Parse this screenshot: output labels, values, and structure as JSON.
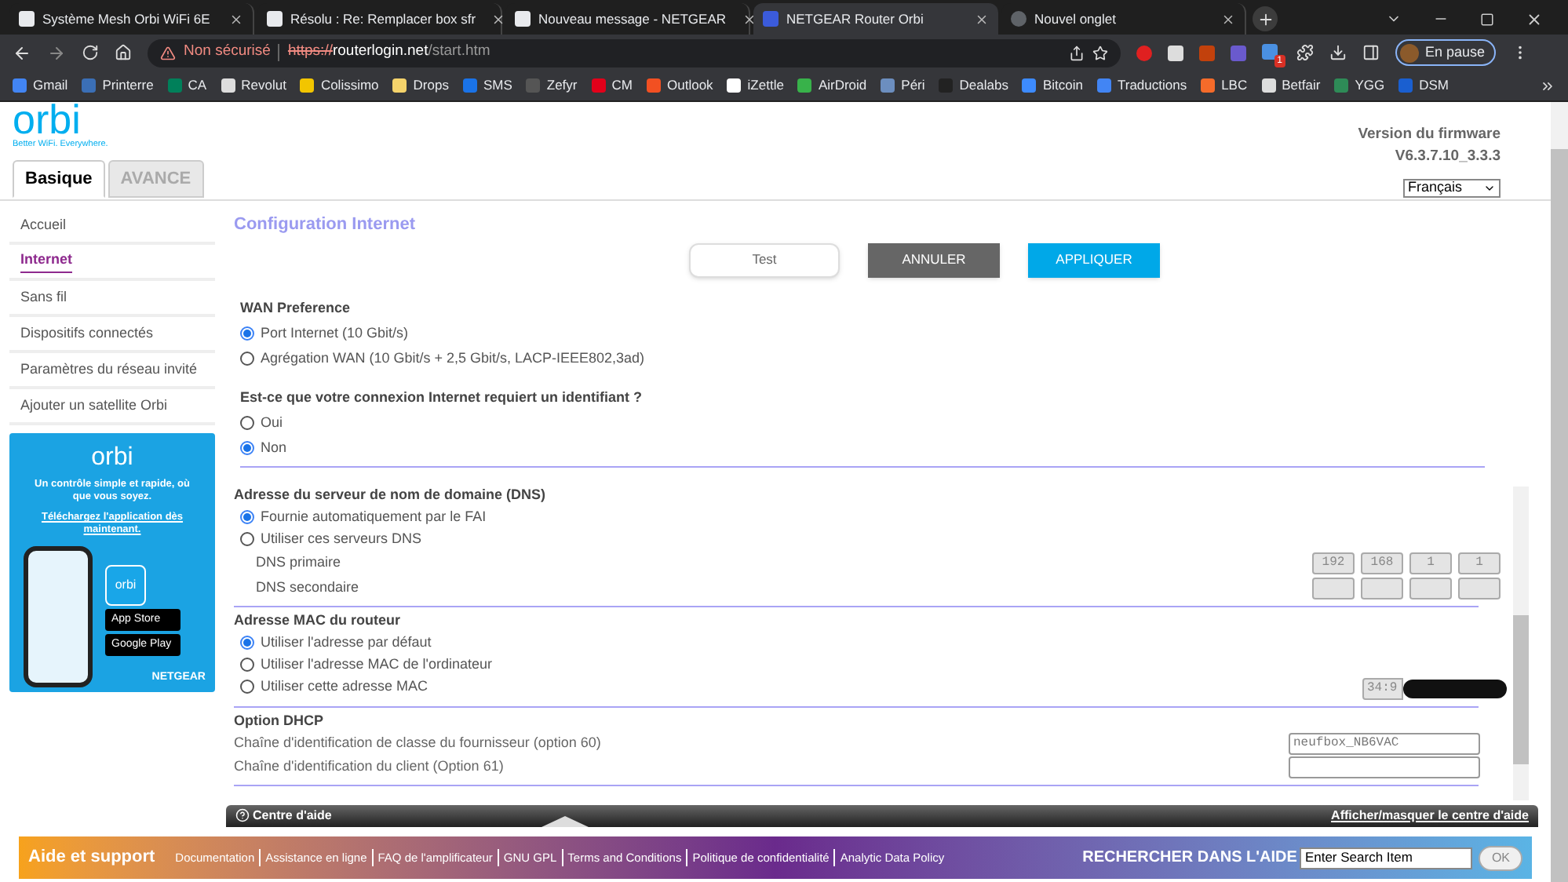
{
  "browser_tabs": [
    {
      "title": "Système Mesh Orbi WiFi 6E",
      "selected": false
    },
    {
      "title": "Résolu : Re: Remplacer box sfr",
      "selected": false
    },
    {
      "title": "Nouveau message - NETGEAR",
      "selected": false
    },
    {
      "title": "NETGEAR Router Orbi",
      "selected": true
    },
    {
      "title": "Nouvel onglet",
      "selected": false
    }
  ],
  "address_bar": {
    "security": "Non sécurisé",
    "url_scheme": "https://",
    "url_host": "routerlogin.net",
    "url_path": "/start.htm"
  },
  "profile": {
    "label": "En pause"
  },
  "extension_badge": "1",
  "bookmarks": [
    {
      "label": "Gmail",
      "color": "#4285f4"
    },
    {
      "label": "Printerre",
      "color": "#3b6fb6"
    },
    {
      "label": "CA",
      "color": "#00805a"
    },
    {
      "label": "Revolut",
      "color": "#dddddd"
    },
    {
      "label": "Colissimo",
      "color": "#f2c500"
    },
    {
      "label": "Drops",
      "color": "#f5d36b"
    },
    {
      "label": "SMS",
      "color": "#1a73e8"
    },
    {
      "label": "Zefyr",
      "color": "#555555"
    },
    {
      "label": "CM",
      "color": "#e2001a"
    },
    {
      "label": "Outlook",
      "color": "#f25022"
    },
    {
      "label": "iZettle",
      "color": "#ffffff"
    },
    {
      "label": "AirDroid",
      "color": "#38b24a"
    },
    {
      "label": "Péri",
      "color": "#6c8ebf"
    },
    {
      "label": "Dealabs",
      "color": "#222222"
    },
    {
      "label": "Bitcoin",
      "color": "#3d8bff"
    },
    {
      "label": "Traductions",
      "color": "#4285f4"
    },
    {
      "label": "LBC",
      "color": "#f56b2a"
    },
    {
      "label": "Betfair",
      "color": "#dddddd"
    },
    {
      "label": "YGG",
      "color": "#2e8b57"
    },
    {
      "label": "DSM",
      "color": "#1a5fd0"
    }
  ],
  "header": {
    "logo": "orbi",
    "tagline": "Better WiFi. Everywhere.",
    "firmware_label": "Version du firmware",
    "firmware_version": "V6.3.7.10_3.3.3",
    "language": "Français"
  },
  "mode_tabs": [
    {
      "label": "Basique",
      "selected": true
    },
    {
      "label": "AVANCE",
      "selected": false
    }
  ],
  "sidebar": {
    "items": [
      {
        "label": "Accueil",
        "selected": false
      },
      {
        "label": "Internet",
        "selected": true
      },
      {
        "label": "Sans fil",
        "selected": false
      },
      {
        "label": "Dispositifs connectés",
        "selected": false
      },
      {
        "label": "Paramètres du réseau invité",
        "selected": false
      },
      {
        "label": "Ajouter un satellite Orbi",
        "selected": false
      }
    ],
    "promo": {
      "logo": "orbi",
      "text": "Un contrôle simple et rapide, où que vous soyez.",
      "link": "Téléchargez l'application dès maintenant.",
      "app_icon": "orbi",
      "app_store": "App Store",
      "google_play": "Google Play",
      "brand": "NETGEAR"
    }
  },
  "page_title": "Configuration Internet",
  "actions": [
    {
      "label": "Test",
      "kind": "plain"
    },
    {
      "label": "ANNULER",
      "kind": "dark"
    },
    {
      "label": "APPLIQUER",
      "kind": "primary"
    }
  ],
  "wan_preference": {
    "title": "WAN Preference",
    "options": [
      {
        "label": "Port Internet (10 Gbit/s)",
        "selected": true
      },
      {
        "label": "Agrégation WAN (10 Gbit/s + 2,5 Gbit/s, LACP-IEEE802,3ad)",
        "selected": false
      }
    ]
  },
  "login_required": {
    "title": "Est-ce que votre connexion Internet requiert un identifiant ?",
    "options": [
      {
        "label": "Oui",
        "selected": false
      },
      {
        "label": "Non",
        "selected": true
      }
    ]
  },
  "dns": {
    "title": "Adresse du serveur de nom de domaine (DNS)",
    "options": [
      {
        "label": "Fournie automatiquement par le FAI",
        "selected": true
      },
      {
        "label": "Utiliser ces serveurs DNS",
        "selected": false
      }
    ],
    "fields": [
      {
        "label": "DNS primaire",
        "disabled": true,
        "octets": [
          "192",
          "168",
          "1",
          "1"
        ]
      },
      {
        "label": "DNS secondaire",
        "disabled": true
      }
    ]
  },
  "mac": {
    "title": "Adresse MAC du routeur",
    "options": [
      {
        "label": "Utiliser l'adresse par défaut",
        "selected": true
      },
      {
        "label": "Utiliser l'adresse MAC de l'ordinateur",
        "selected": false
      },
      {
        "label": "Utiliser cette adresse MAC",
        "selected": false
      }
    ],
    "value": "34:9",
    "disabled": true
  },
  "dhcp": {
    "title": "Option DHCP",
    "fields": [
      {
        "label": "Chaîne d'identification de classe du fournisseur (option 60)",
        "value": "neufbox_NB6VAC"
      },
      {
        "label": "Chaîne d'identification du client (Option 61)"
      }
    ]
  },
  "help_bar": {
    "title": "Centre d'aide",
    "toggle": "Afficher/masquer le centre d'aide"
  },
  "footer": {
    "title": "Aide et support",
    "links": [
      "Documentation",
      "Assistance en ligne",
      "FAQ de l'amplificateur",
      "GNU GPL",
      "Terms and Conditions",
      "Politique de confidentialité",
      "Analytic Data Policy"
    ],
    "search_label": "RECHERCHER DANS L'AIDE",
    "search_value": "Enter Search Item",
    "search_button": "OK"
  }
}
